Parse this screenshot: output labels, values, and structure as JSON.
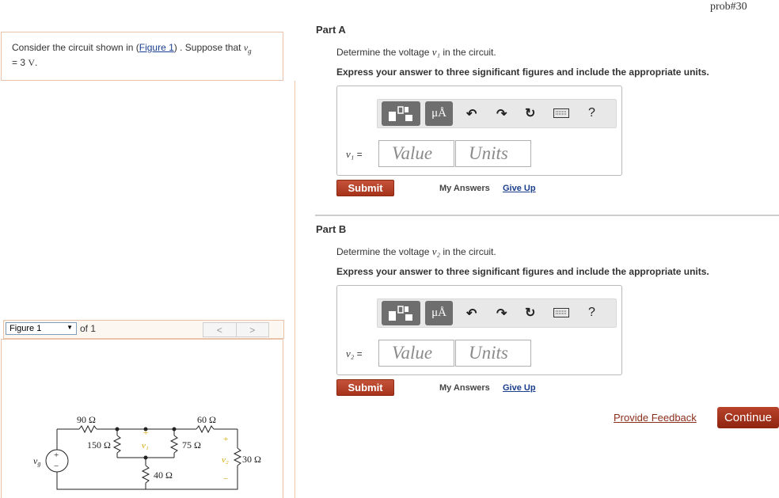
{
  "header": {
    "problem_id": "prob#30"
  },
  "intro": {
    "text_before": "Consider the circuit shown in (",
    "figure_link": "Figure 1",
    "text_after": ") . Suppose that ",
    "var": "v",
    "var_sub": "g",
    "value_line": "= 3 ",
    "unit": "V",
    "period": "."
  },
  "figure_nav": {
    "selected": "Figure 1",
    "of_label": "of 1",
    "prev": "<",
    "next": ">"
  },
  "circuit": {
    "r1": "90 Ω",
    "r2": "150 Ω",
    "r3": "75 Ω",
    "r4": "60 Ω",
    "r5": "40 Ω",
    "r6": "30 Ω",
    "v1": "v₁",
    "v2": "v₂",
    "vg": "v",
    "vg_sub": "g",
    "plus": "+",
    "minus": "−"
  },
  "part_a": {
    "title": "Part A",
    "question_before": "Determine the voltage ",
    "var": "v₁",
    "question_after": " in the circuit.",
    "instructions": "Express your answer to three significant figures and include the appropriate units.",
    "var_label": "v₁",
    "eq": " =",
    "value_placeholder": "Value",
    "units_placeholder": "Units",
    "submit": "Submit",
    "my_answers": "My Answers",
    "give_up": "Give Up"
  },
  "part_b": {
    "title": "Part B",
    "question_before": "Determine the voltage ",
    "var": "v₂",
    "question_after": " in the circuit.",
    "instructions": "Express your answer to three significant figures and include the appropriate units.",
    "var_label": "v₂",
    "eq": " =",
    "value_placeholder": "Value",
    "units_placeholder": "Units",
    "submit": "Submit",
    "my_answers": "My Answers",
    "give_up": "Give Up"
  },
  "toolbar": {
    "mu_label": "μÅ",
    "help": "?",
    "icons": [
      "template-icon",
      "undo-icon",
      "redo-icon",
      "reset-icon",
      "keyboard-icon",
      "help-icon"
    ]
  },
  "footer": {
    "feedback": "Provide Feedback",
    "continue": "Continue"
  },
  "colors": {
    "accent": "#a6321a",
    "link": "#1a3e8c",
    "panel_border": "#e9c3a9",
    "circuit_label": "#d4a500"
  }
}
